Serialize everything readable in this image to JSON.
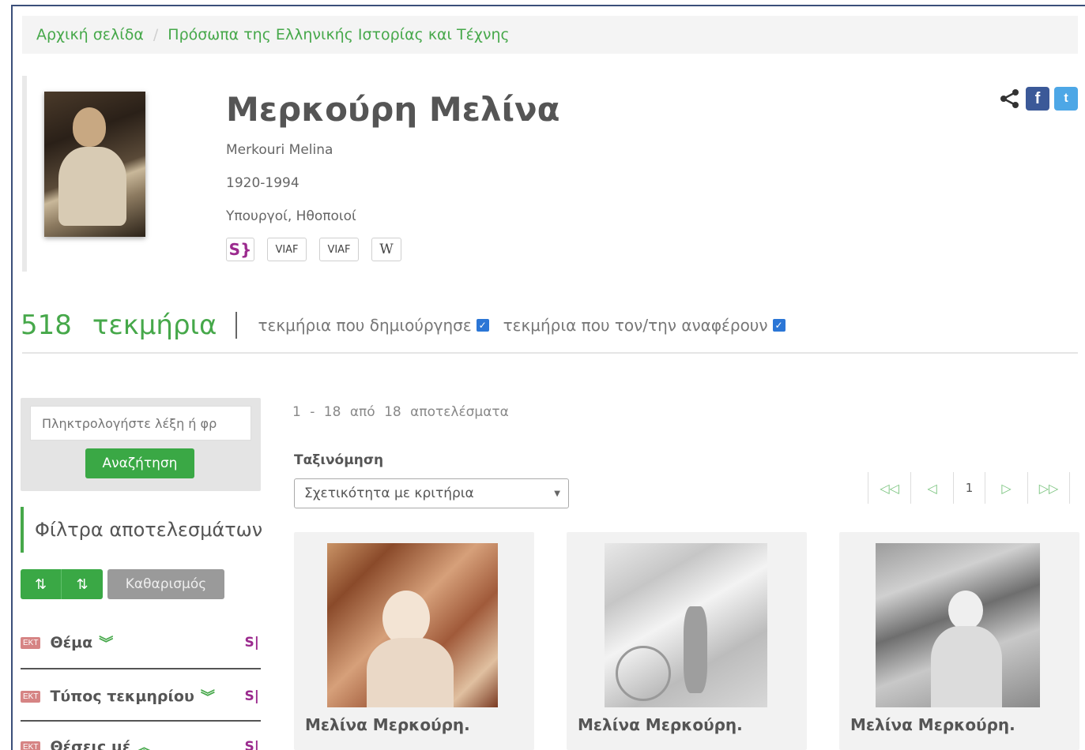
{
  "breadcrumb": {
    "home": "Αρχική σελίδα",
    "separator": "/",
    "current": "Πρόσωπα της Ελληνικής Ιστορίας και Τέχνης"
  },
  "person": {
    "name": "Μερκούρη Μελίνα",
    "latin_name": "Merkouri Melina",
    "years": "1920-1994",
    "roles": "Υπουργοί, Ηθοποιοί",
    "identifiers": [
      "S}",
      "VIAF",
      "VIAF",
      "W"
    ]
  },
  "share": {
    "facebook": "f",
    "twitter": "t"
  },
  "counts": {
    "number": "518",
    "label": "τεκμήρια",
    "created_label": "τεκμήρια που δημιούργησε",
    "mentioned_label": "τεκμήρια που τον/την αναφέρουν",
    "created_checked": true,
    "mentioned_checked": true
  },
  "search": {
    "placeholder": "Πληκτρολογήστε λέξη ή φρ",
    "button": "Αναζήτηση"
  },
  "filters": {
    "title": "Φίλτρα αποτελεσμάτων",
    "clear": "Καθαρισμός",
    "facets": [
      {
        "label": "Θέμα",
        "badge": "ΕΚΤ",
        "source": "S|"
      },
      {
        "label": "Τύπος τεκμηρίου",
        "badge": "ΕΚΤ",
        "source": "S|"
      },
      {
        "label": "Θέσεις μέ",
        "badge": "ΕΚΤ",
        "source": "S|"
      }
    ]
  },
  "results": {
    "from": "1",
    "dash": "-",
    "to": "18",
    "of": "από",
    "total": "18",
    "word": "αποτελέσματα",
    "sort_label": "Ταξινόμηση",
    "sort_value": "Σχετικότητα με κριτήρια",
    "page": "1",
    "items": [
      {
        "title": "Μελίνα Μερκούρη."
      },
      {
        "title": "Μελίνα Μερκούρη."
      },
      {
        "title": "Μελίνα Μερκούρη."
      }
    ]
  },
  "colors": {
    "accent": "#46a84a",
    "button": "#3aa845",
    "checkbox": "#2b76d6",
    "facebook": "#3b5998",
    "twitter": "#4da7e6"
  }
}
